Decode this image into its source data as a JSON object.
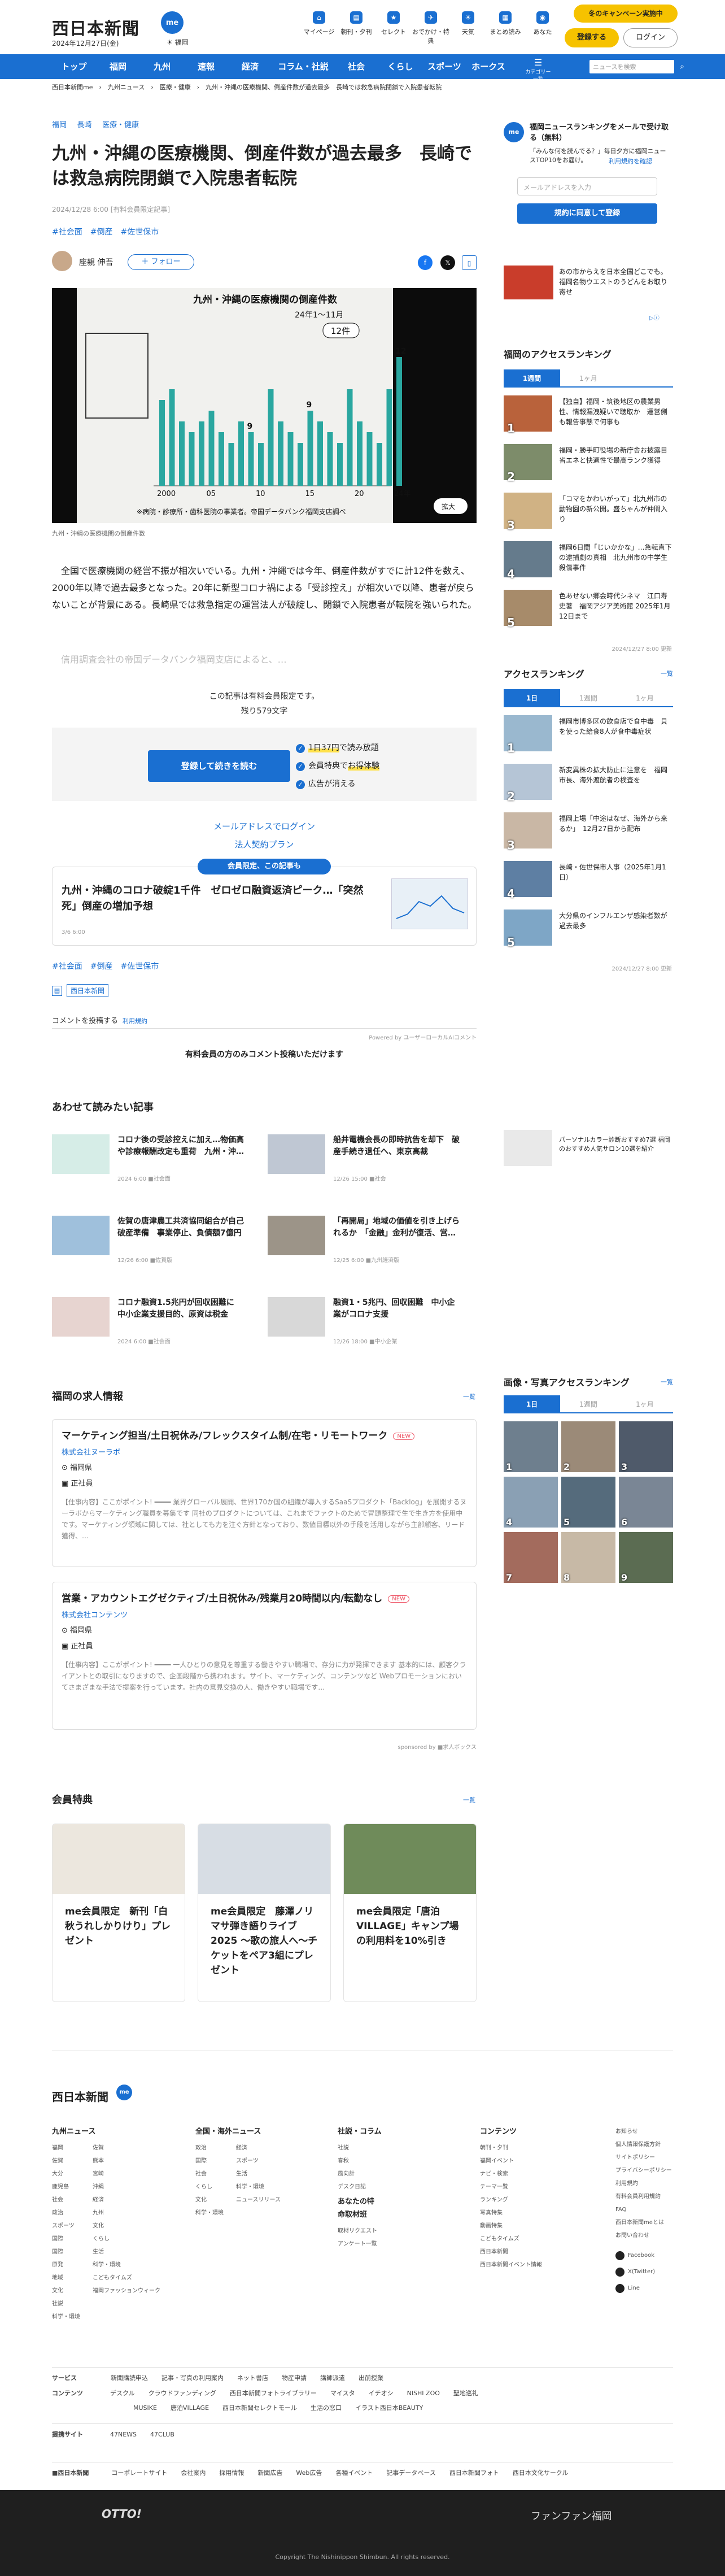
{
  "header": {
    "logo": "西日本新聞",
    "me": "me",
    "date": "2024年12月27日(金)",
    "weather": "☀ 福岡",
    "icons": [
      {
        "label": "マイページ",
        "g": "⌂"
      },
      {
        "label": "朝刊・夕刊",
        "g": "▤"
      },
      {
        "label": "セレクト",
        "g": "★"
      },
      {
        "label": "おでかけ・特典",
        "g": "✈"
      },
      {
        "label": "天気",
        "g": "☀"
      },
      {
        "label": "まとめ読み",
        "g": "▦"
      },
      {
        "label": "あなた",
        "g": "◉"
      }
    ],
    "campaign": "冬のキャンペーン実施中",
    "register": "登録する",
    "login": "ログイン"
  },
  "nav": {
    "items": [
      "トップ",
      "福岡",
      "九州",
      "速報",
      "経済",
      "コラム・社説",
      "社会",
      "くらし",
      "スポーツ",
      "ホークス"
    ],
    "category": "カテゴリー一覧",
    "search_placeholder": "ニュースを検索"
  },
  "breadcrumb": "西日本新聞me　›　九州ニュース　›　医療・健康　›　九州・沖縄の医療機関、倒産件数が過去最多　長崎では救急病院閉鎖で入院患者転院",
  "article": {
    "tags": [
      "福岡",
      "長崎",
      "医療・健康"
    ],
    "title": "九州・沖縄の医療機関、倒産件数が過去最多　長崎では救急病院閉鎖で入院患者転院",
    "date": "2024/12/28 6:00 [有料会員限定記事]",
    "keywords": "#社会面　#倒産　#佐世保市",
    "author": "座親 伸吾",
    "follow": "＋ フォロー",
    "photo": {
      "heading": "九州・沖縄の医療機関の倒産件数",
      "period": "24年1～11月",
      "pill": "12件",
      "vals": [
        8,
        9,
        6,
        5,
        6,
        7,
        5,
        4,
        6,
        5,
        4,
        9,
        6,
        5,
        4,
        7,
        6,
        5,
        4,
        9,
        6,
        5,
        4,
        9,
        12
      ],
      "xlabels": [
        "2000",
        "05",
        "10",
        "15",
        "20",
        "24年"
      ],
      "note": "※病院・診療所・歯科医院の事業者。帝国データバンク福岡支店調べ",
      "zoom": "拡大",
      "labels9": [
        "9",
        "9"
      ],
      "label12": "12"
    },
    "caption": "九州・沖縄の医療機関の倒産件数",
    "body": "全国で医療機関の経営不振が相次いでいる。九州・沖縄では今年、倒産件数がすでに計12件を数え、2000年以降で過去最多となった。20年に新型コロナ禍による「受診控え」が相次いで以降、患者が戻らないことが背景にある。長崎県では救急指定の運営法人が破綻し、閉鎖で入院患者が転院を強いられた。",
    "fade": "信用調査会社の帝国データバンク福岡支店によると、…",
    "paywall": {
      "l1": "この記事は有料会員限定です。",
      "l2": "残り579文字",
      "button": "登録して続きを読む",
      "b1": "1日37円",
      "b1b": "で読み放題",
      "b2": "会員特典で",
      "b2b": "お得体験",
      "b3": "広告が消える",
      "email_login": "メールアドレスでログイン",
      "corp": "法人契約プラン"
    },
    "related": {
      "label": "会員限定、この記事も",
      "title": "九州・沖縄のコロナ破綻1千件　ゼロゼロ融資返済ピーク…「突然死」倒産の増加予想",
      "date": "3/6 6:00"
    },
    "bottom_tags": "#社会面　#倒産　#佐世保市",
    "source": "西日本新聞",
    "comment": "コメントを投稿する",
    "comment_link": "利用規約",
    "powered": "Powered by ユーザーローカルAIコメント",
    "comment_note": "有料会員の方のみコメント投稿いただけます"
  },
  "reads": {
    "title": "あわせて読みたい記事",
    "items": [
      {
        "t": "コロナ後の受診控えに加え…物価高や診療報酬改定も重荷　九州・沖…",
        "d": "2024 6:00 ■社会面"
      },
      {
        "t": "船井電機会長の即時抗告を却下　破産手続き退任へ、東京高裁",
        "d": "12/26 15:00 ■社会"
      },
      {
        "t": "佐賀の唐津農工共済協同組合が自己破産準備　事業停止、負債額7億円",
        "d": "12/26 6:00 ■佐賀版"
      },
      {
        "t": "「再開局」地域の価値を引き上げられるか　「金融」金利が復活、営…",
        "d": "12/25 6:00 ■九州経済版"
      },
      {
        "t": "コロナ融資1.5兆円が回収困難に　中小企業支援目的、原資は税金",
        "d": "2024 6:00 ■社会面"
      },
      {
        "t": "融資1・5兆円、回収困難　中小企業がコロナ支援",
        "d": "12/26 18:00 ■中小企業"
      }
    ]
  },
  "jobs": {
    "title": "福岡の求人情報",
    "more": "一覧",
    "items": [
      {
        "t": "マーケティング担当/土日祝休み/フレックスタイム制/在宅・リモートワーク",
        "badge": "NEW",
        "co": "株式会社ヌーラボ",
        "loc": "福岡県",
        "emp": "正社員",
        "desc": "【仕事内容】ここがポイント! ━━━━ 業界グローバル展開、世界170か国の組織が導入するSaaSプロダクト「Backlog」を展開するヌーラボからマーケティング職員を募集です 同社のプロダクトについては、これまでファクトのためで冒頭整理で生で生き方を使用中です。マーケティング領域に関しては、社としても力を注ぐ方針となっており、数値目標以外の手段を活用しながら主部顧客、リード獲得、…"
      },
      {
        "t": "営業・アカウントエグゼクティブ/土日祝休み/残業月20時間以内/転勤なし",
        "badge": "NEW",
        "co": "株式会社コンテンツ",
        "loc": "福岡県",
        "emp": "正社員",
        "desc": "【仕事内容】ここがポイント! ━━━━ 一人ひとりの意見を尊重する働きやすい職場で、存分に力が発揮できます 基本的には、顧客クライアントとの取引になりますので、企画段階から携われます。サイト、マーケティング、コンテンツなど Webプロモーションにおいてさまざまな手法で提案を行っています。社内の意見交換の人、働きやすい職場です…"
      }
    ],
    "powered": "sponsored by ■求人ボックス"
  },
  "perks": {
    "title": "会員特典",
    "more": "一覧",
    "items": [
      "me会員限定　新刊「白秋うれしかりけり」プレゼント",
      "me会員限定　藤澤ノリマサ弾き語りライブ2025 ～歌の旅人へ～チケットをペア3組にプレゼント",
      "me会員限定「唐泊VILLAGE」キャンプ場の利用料を10%引き"
    ]
  },
  "sidebar": {
    "newsletter": {
      "title": "福岡ニュースランキングをメールで受け取る（無料）",
      "text": "「みんな何を読んでる？」毎日夕方に福岡ニュースTOP10をお届け。",
      "link": "利用規約を確認",
      "placeholder": "メールアドレスを入力",
      "button": "規約に同意して登録"
    },
    "promo": "あの市からえを日本全国どこでも。福岡名物ウエストのうどんをお取り寄せ",
    "ranking1": {
      "title": "福岡のアクセスランキング",
      "tabs": [
        "1週間",
        "1ヶ月"
      ],
      "items": [
        "【独自】福岡・筑後地区の農業男性、情報漏洩疑いで聴取か　運営側も報告事態で何事も",
        "福岡・勝手町役場の新庁舎お披露目　省エネと快適性で最高ランク獲得",
        "「コマをかわいがって」北九州市の動物園の新公開。盛ちゃんが仲間入り",
        "福岡6日間「じいかかな」…急転直下の逮捕劇の真相　北九州市の中学生殺傷事件",
        "色あせない郷会時代シネマ　江口寿史著　福岡アジア美術館 2025年1月12日まで"
      ],
      "updated": "2024/12/27 8:00 更新"
    },
    "ranking2": {
      "title": "アクセスランキング",
      "more": "一覧",
      "tabs": [
        "1日",
        "1週間",
        "1ヶ月"
      ],
      "items": [
        "福岡市博多区の飲食店で食中毒　貝を使った給食8人が食中毒症状",
        "新変異株の拡大防止に注意を　福岡市長、海外渡航者の検査を",
        "福岡上場「中途はなぜ、海外から来るか」　12月27日から配布",
        "長崎・佐世保市人事（2025年1月1日）",
        "大分県のインフルエンザ感染者数が過去最多"
      ],
      "updated": "2024/12/27 8:00 更新"
    },
    "ad2": "パーソナルカラー診断おすすめ7選 福岡のおすすめ人気サロン10選を紹介",
    "photo_rank": {
      "title": "画像・写真アクセスランキング",
      "more": "一覧",
      "tabs": [
        "1日",
        "1週間",
        "1ヶ月"
      ]
    }
  },
  "footer": {
    "logo": "西日本新聞",
    "cols": [
      {
        "h": "九州ニュース",
        "items": [
          "福岡",
          "佐賀",
          "大分",
          "鹿児島",
          "社会",
          "政治",
          "スポーツ",
          "国際",
          "国際",
          "原発",
          "地域",
          "文化",
          "社説",
          "科学・環境"
        ],
        "items2": [
          "佐賀",
          "熊本",
          "宮崎",
          "沖縄",
          "経済",
          "九州",
          "文化",
          "くらし",
          "生活",
          "科学・環境",
          "こどもタイムズ",
          "福岡ファッションウィーク"
        ]
      },
      {
        "h": "全国・海外ニュース",
        "items": [
          "政治",
          "国際",
          "社会",
          "くらし",
          "文化",
          "科学・環境"
        ],
        "items2": [
          "経済",
          "スポーツ",
          "生活",
          "科学・環境",
          "ニュースリリース"
        ]
      },
      {
        "h": "社説・コラム",
        "items": [
          "社説",
          "春秋",
          "風向計",
          "デスク日記"
        ],
        "h2": "あなたの特命取材班",
        "items2": [
          "取材リクエスト",
          "アンケート一覧"
        ]
      },
      {
        "h": "コンテンツ",
        "items": [
          "朝刊・夕刊",
          "福岡イベント",
          "ナビ・検索",
          "テーマ一覧",
          "ランキング",
          "写真特集",
          "動画特集",
          "こどもタイムズ",
          "西日本新聞",
          "西日本新聞イベント情報"
        ]
      },
      {
        "h": "",
        "items": [
          "お知らせ",
          "個人情報保護方針",
          "サイトポリシー",
          "プライバシーポリシー",
          "利用規約",
          "有料会員利用規約",
          "FAQ",
          "西日本新聞meとは",
          "お問い合わせ"
        ],
        "social": [
          "Facebook",
          "X(Twitter)",
          "Line"
        ]
      }
    ],
    "services": {
      "label": "サービス",
      "items": [
        "新聞購読申込",
        "記事・写真の利用案内",
        "ネット書店",
        "物産申請",
        "講師派遣",
        "出前授業"
      ]
    },
    "contents": {
      "label": "コンテンツ",
      "items": [
        "デスクル",
        "クラウドファンディング",
        "西日本新聞フォトライブラリー",
        "マイスタ",
        "イチオシ",
        "NISHI ZOO",
        "聖地巡礼"
      ],
      "items2": [
        "MUSIKE",
        "唐泊VILLAGE",
        "西日本新聞セレクトモール",
        "生活の窓口",
        "イラスト西日本BEAUTY"
      ]
    },
    "partner": {
      "label": "提携サイト",
      "items": [
        "47NEWS",
        "47CLUB"
      ]
    },
    "corp": {
      "logo": "■西日本新聞",
      "items": [
        "コーポレートサイト",
        "会社案内",
        "採用情報",
        "新聞広告",
        "Web広告",
        "各種イベント",
        "記事データベース",
        "西日本新聞フォト",
        "西日本文化サークル"
      ]
    },
    "dark": {
      "left": "OTTO!",
      "right": "ファンファン福岡",
      "copyright": "Copyright The Nishinippon Shimbun. All rights reserved."
    }
  },
  "colors": {
    "brand": "#1a6fd1",
    "accent": "#f6c200",
    "bar": "#2aa7a0"
  }
}
